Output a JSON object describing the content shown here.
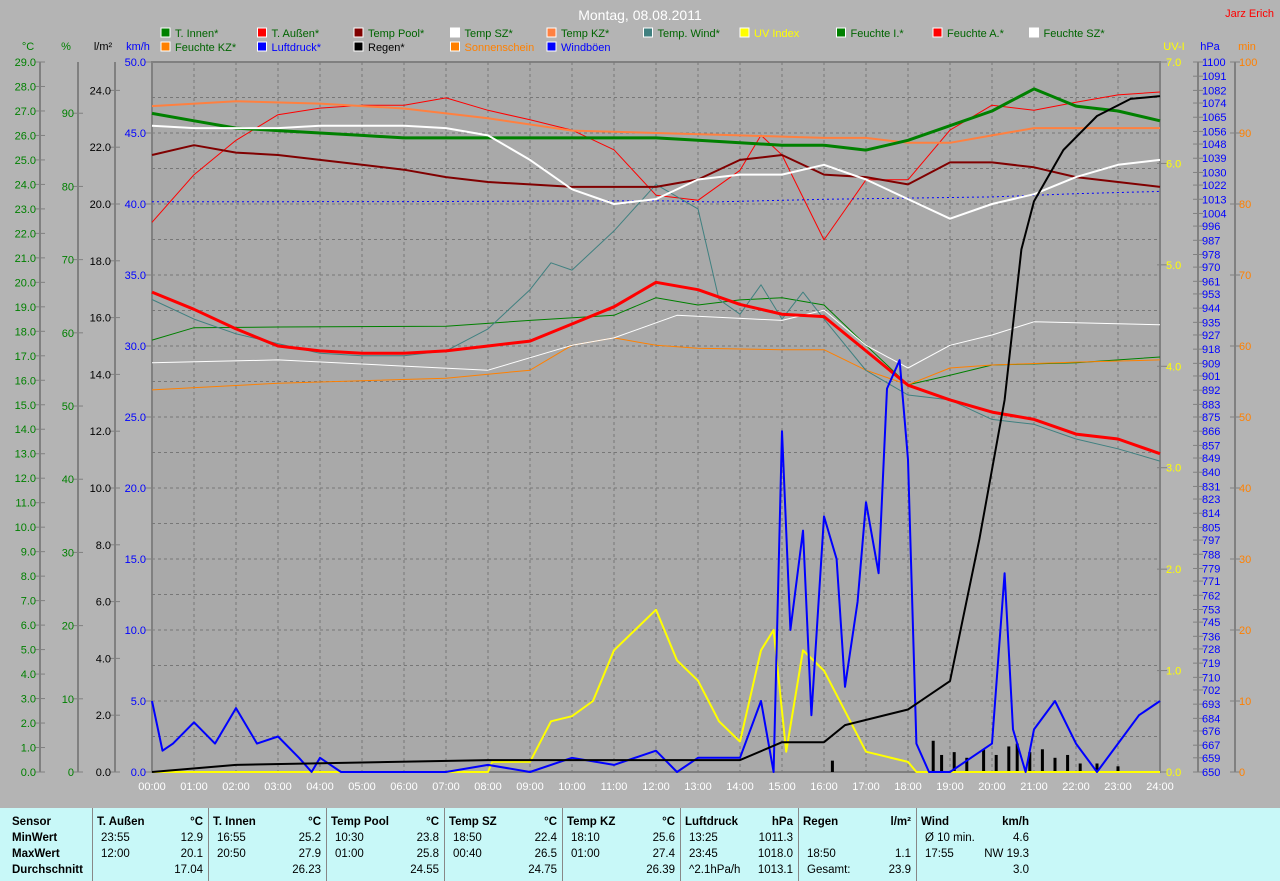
{
  "title": "Montag, 08.08.2011",
  "author": "Jarz Erich",
  "legend": [
    {
      "label": "T. Innen*",
      "color": "#008000",
      "text": "#006400"
    },
    {
      "label": "T. Außen*",
      "color": "#ff0000",
      "text": "#006400"
    },
    {
      "label": "Temp Pool*",
      "color": "#800000",
      "text": "#006400"
    },
    {
      "label": "Temp SZ*",
      "color": "#ffffff",
      "text": "#006400"
    },
    {
      "label": "Temp KZ*",
      "color": "#ff8040",
      "text": "#006400"
    },
    {
      "label": "Temp. Wind*",
      "color": "#408080",
      "text": "#006400"
    },
    {
      "label": "UV Index",
      "color": "#ffff00",
      "text": "#ffff00"
    },
    {
      "label": "Feuchte I.*",
      "color": "#008000",
      "text": "#006400"
    },
    {
      "label": "Feuchte A.*",
      "color": "#ff0000",
      "text": "#006400"
    },
    {
      "label": "Feuchte SZ*",
      "color": "#ffffff",
      "text": "#006400"
    },
    {
      "label": "Feuchte KZ*",
      "color": "#ff8000",
      "text": "#006400"
    },
    {
      "label": "Luftdruck*",
      "color": "#0000ff",
      "text": "#0000ff"
    },
    {
      "label": "Regen*",
      "color": "#000000",
      "text": "#000000"
    },
    {
      "label": "Sonnenschein",
      "color": "#ff8000",
      "text": "#ff8000"
    },
    {
      "label": "Windböen",
      "color": "#0000ff",
      "text": "#0000ff"
    }
  ],
  "chart_data": {
    "type": "line",
    "title": "Montag, 08.08.2011",
    "xlabel": "",
    "xlim": [
      0,
      24
    ],
    "x_ticks": [
      "00:00",
      "01:00",
      "02:00",
      "03:00",
      "04:00",
      "05:00",
      "06:00",
      "07:00",
      "08:00",
      "09:00",
      "10:00",
      "11:00",
      "12:00",
      "13:00",
      "14:00",
      "15:00",
      "16:00",
      "17:00",
      "18:00",
      "19:00",
      "20:00",
      "21:00",
      "22:00",
      "23:00",
      "24:00"
    ],
    "axes": {
      "C": {
        "unit": "°C",
        "range": [
          0,
          29
        ],
        "color": "#008000",
        "ticks": [
          "0.0",
          "1.0",
          "2.0",
          "3.0",
          "4.0",
          "5.0",
          "6.0",
          "7.0",
          "8.0",
          "9.0",
          "10.0",
          "11.0",
          "12.0",
          "13.0",
          "14.0",
          "15.0",
          "16.0",
          "17.0",
          "18.0",
          "19.0",
          "20.0",
          "21.0",
          "22.0",
          "23.0",
          "24.0",
          "25.0",
          "26.0",
          "27.0",
          "28.0",
          "29.0"
        ]
      },
      "pct": {
        "unit": "%",
        "range": [
          0,
          97
        ],
        "color": "#008000",
        "ticks": [
          "0",
          "10",
          "20",
          "30",
          "40",
          "50",
          "60",
          "70",
          "80",
          "90"
        ]
      },
      "lm2": {
        "unit": "l/m²",
        "range": [
          0,
          25
        ],
        "color": "#000000",
        "ticks": [
          "0.0",
          "2.0",
          "4.0",
          "6.0",
          "8.0",
          "10.0",
          "12.0",
          "14.0",
          "16.0",
          "18.0",
          "20.0",
          "22.0",
          "24.0"
        ]
      },
      "kmh": {
        "unit": "km/h",
        "range": [
          0,
          50
        ],
        "color": "#0000ff",
        "ticks": [
          "0.0",
          "5.0",
          "10.0",
          "15.0",
          "20.0",
          "25.0",
          "30.0",
          "35.0",
          "40.0",
          "45.0",
          "50.0"
        ]
      },
      "uv": {
        "unit": "UV-I",
        "range": [
          0,
          7
        ],
        "color": "#ffff00",
        "ticks": [
          "0.0",
          "1.0",
          "2.0",
          "3.0",
          "4.0",
          "5.0",
          "6.0",
          "7.0"
        ]
      },
      "hpa": {
        "unit": "hPa",
        "range": [
          650,
          1100
        ],
        "color": "#0000ff",
        "ticks": [
          "650",
          "659",
          "667",
          "676",
          "684",
          "693",
          "702",
          "710",
          "719",
          "728",
          "736",
          "745",
          "753",
          "762",
          "771",
          "779",
          "788",
          "797",
          "805",
          "814",
          "823",
          "831",
          "840",
          "849",
          "857",
          "866",
          "875",
          "883",
          "892",
          "901",
          "909",
          "918",
          "927",
          "935",
          "944",
          "953",
          "961",
          "970",
          "978",
          "987",
          "996",
          "1004",
          "1013",
          "1022",
          "1030",
          "1039",
          "1048",
          "1056",
          "1065",
          "1074",
          "1082",
          "1091",
          "1100"
        ]
      },
      "min": {
        "unit": "min",
        "range": [
          0,
          100
        ],
        "color": "#ff8000",
        "ticks": [
          "0",
          "10",
          "20",
          "30",
          "40",
          "50",
          "60",
          "70",
          "80",
          "90",
          "100"
        ]
      }
    },
    "series": [
      {
        "name": "Feuchte A.",
        "axis": "pct",
        "color": "#ff0000",
        "width": 1,
        "x": [
          0,
          1,
          2,
          3,
          4,
          5,
          6,
          7,
          8,
          9,
          10,
          11,
          12,
          13,
          14,
          14.5,
          15,
          16,
          16.5,
          17,
          18,
          19,
          20,
          21,
          22,
          23,
          24
        ],
        "y": [
          75.1,
          81.6,
          86.3,
          89.8,
          90.7,
          91.1,
          91.1,
          92.1,
          90.4,
          89.1,
          87.7,
          85,
          78.8,
          78.1,
          82.2,
          87,
          84.3,
          72.7,
          76.8,
          80.9,
          80.9,
          87.7,
          91.1,
          90.4,
          91.5,
          92.5,
          92.9
        ]
      },
      {
        "name": "Feuchte I.",
        "axis": "pct",
        "color": "#008000",
        "width": 1,
        "x": [
          0,
          1,
          3,
          7,
          9,
          11,
          12,
          13,
          14,
          15,
          16,
          17,
          18,
          19,
          20,
          22,
          24
        ],
        "y": [
          59,
          60.7,
          60.8,
          60.9,
          61.7,
          62.4,
          64.8,
          63.8,
          64.5,
          64.8,
          63.8,
          58.3,
          52.9,
          54.2,
          55.6,
          55.9,
          56.7
        ]
      },
      {
        "name": "Feuchte KZ",
        "axis": "pct",
        "color": "#ff8000",
        "width": 1,
        "x": [
          0,
          3,
          7,
          9,
          10,
          11,
          12,
          13,
          15,
          16,
          17,
          18,
          19,
          20,
          22,
          24
        ],
        "y": [
          52.2,
          53.1,
          53.8,
          54.9,
          58.3,
          59.3,
          58.3,
          57.9,
          57.7,
          57.7,
          54.9,
          52.9,
          55.2,
          55.6,
          56,
          56.3
        ]
      },
      {
        "name": "Feuchte SZ",
        "axis": "pct",
        "color": "#ffffff",
        "width": 1,
        "x": [
          0,
          3,
          8,
          10,
          11,
          12.5,
          15,
          16,
          17,
          18,
          19,
          20,
          21,
          24
        ],
        "y": [
          55.9,
          56.3,
          54.9,
          58.3,
          59.3,
          62.4,
          61.7,
          63.1,
          58.3,
          55.2,
          58.3,
          59.7,
          61.5,
          61.1
        ]
      },
      {
        "name": "Temp. Wind",
        "axis": "C",
        "color": "#408080",
        "width": 1,
        "x": [
          0,
          1,
          2,
          3,
          4,
          5,
          6,
          7,
          8,
          9,
          9.5,
          10,
          11,
          12,
          13,
          13.5,
          14,
          14.5,
          15,
          15.5,
          16,
          17,
          18,
          19,
          20,
          21,
          22,
          23,
          24
        ],
        "y": [
          19.3,
          18.5,
          17.9,
          17.5,
          17.1,
          17,
          17,
          17.2,
          18.1,
          19.7,
          20.8,
          20.5,
          22.1,
          24,
          23,
          19.3,
          18.7,
          19.9,
          18.5,
          19.6,
          18.5,
          16.4,
          15.4,
          15.2,
          14.4,
          14.2,
          13.6,
          13.2,
          12.7
        ]
      },
      {
        "name": "Luftdruck",
        "axis": "hpa",
        "color": "#0000ff",
        "width": 1,
        "dash": true,
        "x": [
          0,
          6,
          12,
          13.4,
          16,
          20,
          22,
          24
        ],
        "y": [
          1011.4,
          1011.5,
          1012,
          1011.3,
          1013,
          1014.5,
          1016.5,
          1018
        ]
      },
      {
        "name": "T. Außen",
        "axis": "C",
        "color": "#ff0000",
        "width": 3,
        "x": [
          0,
          1,
          2,
          3,
          4,
          5,
          6,
          7,
          8,
          9,
          10,
          11,
          12,
          13,
          14,
          15,
          16,
          17,
          18,
          19,
          20,
          21,
          22,
          23,
          24
        ],
        "y": [
          19.6,
          18.9,
          18.1,
          17.4,
          17.2,
          17.1,
          17.1,
          17.2,
          17.4,
          17.6,
          18.3,
          19,
          20,
          19.7,
          19.1,
          18.7,
          18.6,
          17.2,
          15.8,
          15.2,
          14.7,
          14.4,
          13.8,
          13.6,
          13
        ]
      },
      {
        "name": "Temp KZ",
        "axis": "C",
        "color": "#ff8040",
        "width": 2,
        "x": [
          0,
          2,
          4,
          6,
          8,
          10,
          12,
          14,
          16,
          17,
          18,
          19,
          20,
          21,
          22,
          24
        ],
        "y": [
          27.2,
          27.4,
          27.3,
          27.1,
          26.7,
          26.2,
          26.1,
          26,
          25.9,
          25.9,
          25.7,
          25.7,
          26,
          26.3,
          26.3,
          26.3
        ]
      },
      {
        "name": "T. Innen",
        "axis": "C",
        "color": "#008000",
        "width": 3,
        "x": [
          0,
          1,
          2,
          3,
          4,
          5,
          6,
          7,
          8,
          9,
          10,
          11,
          12,
          13,
          14,
          15,
          16,
          17,
          18,
          19,
          20,
          21,
          22,
          23,
          24
        ],
        "y": [
          26.9,
          26.6,
          26.3,
          26.2,
          26.1,
          26,
          25.9,
          25.9,
          25.9,
          25.9,
          25.9,
          25.9,
          25.9,
          25.8,
          25.7,
          25.6,
          25.6,
          25.4,
          25.8,
          26.4,
          27,
          27.9,
          27.2,
          27,
          26.6
        ]
      },
      {
        "name": "Temp Pool",
        "axis": "C",
        "color": "#800000",
        "width": 2,
        "x": [
          0,
          1,
          2,
          3,
          4,
          5,
          6,
          7,
          8,
          9,
          10,
          11,
          12,
          13,
          14,
          15,
          16,
          17,
          18,
          19,
          20,
          21,
          22,
          23,
          24
        ],
        "y": [
          25.2,
          25.6,
          25.3,
          25.2,
          25,
          24.8,
          24.6,
          24.3,
          24.1,
          24,
          23.9,
          23.9,
          23.9,
          24.2,
          25,
          25.2,
          24.4,
          24.3,
          24,
          24.9,
          24.9,
          24.7,
          24.3,
          24.1,
          23.9
        ]
      },
      {
        "name": "Temp SZ",
        "axis": "C",
        "color": "#ffffff",
        "width": 2,
        "x": [
          0,
          1,
          2,
          3,
          4,
          5,
          6,
          7,
          8,
          9,
          10,
          11,
          12,
          13,
          14,
          15,
          16,
          17,
          18,
          19,
          20,
          21,
          22,
          23,
          24
        ],
        "y": [
          26.4,
          26.3,
          26.3,
          26.3,
          26.4,
          26.4,
          26.4,
          26.3,
          26,
          25,
          23.8,
          23.2,
          23.4,
          24.2,
          24.4,
          24.4,
          24.8,
          24.2,
          23.4,
          22.6,
          23.2,
          23.6,
          24.3,
          24.8,
          25
        ]
      },
      {
        "name": "UV Index",
        "axis": "uv",
        "color": "#ffff00",
        "width": 2,
        "x": [
          0,
          8,
          8.1,
          9,
          9.5,
          10,
          10.5,
          11,
          11.5,
          12,
          12.5,
          13,
          13.5,
          14,
          14.5,
          14.8,
          15.1,
          15.5,
          16,
          16.5,
          17,
          18,
          18.2,
          24
        ],
        "y": [
          0,
          0,
          0.1,
          0.1,
          0.5,
          0.55,
          0.7,
          1.2,
          1.4,
          1.6,
          1.1,
          0.9,
          0.5,
          0.3,
          1.2,
          1.4,
          0.2,
          1.2,
          1,
          0.6,
          0.2,
          0.1,
          0,
          0
        ]
      },
      {
        "name": "Windböen",
        "axis": "kmh",
        "color": "#0000ff",
        "width": 2,
        "x": [
          0,
          0.25,
          0.5,
          1,
          1.5,
          2,
          2.5,
          3,
          3.5,
          3.8,
          4,
          4.5,
          5,
          7,
          8,
          9,
          10,
          11,
          12,
          12.5,
          13,
          14,
          14.5,
          14.8,
          15,
          15.2,
          15.5,
          15.7,
          16,
          16.3,
          16.5,
          16.8,
          17,
          17.3,
          17.5,
          17.8,
          18,
          18.2,
          18.5,
          19,
          20,
          20.3,
          20.5,
          20.8,
          21,
          21.5,
          22,
          22.5,
          23,
          23.5,
          24
        ],
        "y": [
          5,
          1.5,
          2,
          3.5,
          2,
          4.5,
          2,
          2.5,
          1,
          0,
          1,
          0,
          0,
          0,
          0.5,
          0,
          1,
          0.5,
          1.5,
          0,
          1,
          1,
          5,
          0,
          24,
          10,
          17,
          4,
          18,
          15,
          6,
          12,
          19,
          14,
          27,
          29,
          22,
          2,
          0,
          0,
          2,
          14,
          3,
          0,
          3,
          5,
          2,
          0,
          2,
          4,
          5
        ]
      },
      {
        "name": "Regen",
        "axis": "lm2",
        "color": "#000000",
        "width": 2,
        "x": [
          0,
          2,
          8,
          14,
          15,
          16,
          16.5,
          18,
          18.2,
          19,
          19.7,
          20.3,
          20.7,
          21,
          21.7,
          22.5,
          23.3,
          24
        ],
        "y": [
          0,
          0.25,
          0.42,
          0.42,
          1.05,
          1.05,
          1.65,
          2.2,
          2.4,
          3.2,
          8.2,
          13.1,
          18.4,
          20.1,
          21.9,
          23.1,
          23.7,
          23.8
        ]
      }
    ],
    "rain_bars": {
      "axis": "lm2",
      "color": "#000000",
      "x": [
        16.2,
        18.6,
        18.8,
        19.1,
        19.4,
        19.8,
        20.1,
        20.4,
        20.6,
        20.9,
        21.2,
        21.5,
        21.8,
        22.1,
        22.5,
        23
      ],
      "y": [
        0.4,
        1.1,
        0.6,
        0.7,
        0.5,
        0.8,
        0.6,
        0.9,
        1,
        0.7,
        0.8,
        0.5,
        0.6,
        0.3,
        0.3,
        0.2
      ]
    }
  },
  "table": {
    "columns": [
      {
        "h": "Sensor",
        "rows": [
          "MinWert",
          "MaxWert",
          "Durchschnitt"
        ],
        "bold": true
      },
      {
        "h": "T. Außen",
        "u": "°C",
        "t": [
          "23:55",
          "12:00",
          ""
        ],
        "v": [
          "12.9",
          "20.1",
          "17.04"
        ]
      },
      {
        "h": "T. Innen",
        "u": "°C",
        "t": [
          "16:55",
          "20:50",
          ""
        ],
        "v": [
          "25.2",
          "27.9",
          "26.23"
        ]
      },
      {
        "h": "Temp Pool",
        "u": "°C",
        "t": [
          "10:30",
          "01:00",
          ""
        ],
        "v": [
          "23.8",
          "25.8",
          "24.55"
        ]
      },
      {
        "h": "Temp SZ",
        "u": "°C",
        "t": [
          "18:50",
          "00:40",
          ""
        ],
        "v": [
          "22.4",
          "26.5",
          "24.75"
        ]
      },
      {
        "h": "Temp KZ",
        "u": "°C",
        "t": [
          "18:10",
          "01:00",
          ""
        ],
        "v": [
          "25.6",
          "27.4",
          "26.39"
        ]
      },
      {
        "h": "Luftdruck",
        "u": "hPa",
        "t": [
          "13:25",
          "23:45",
          "^2.1hPa/h"
        ],
        "v": [
          "1011.3",
          "1018.0",
          "1013.1"
        ]
      },
      {
        "h": "Regen",
        "u": "l/m²",
        "t": [
          "",
          "18:50",
          "Gesamt:"
        ],
        "v": [
          "",
          "1.1",
          "23.9"
        ]
      },
      {
        "h": "Wind",
        "u": "km/h",
        "t": [
          "Ø 10 min.",
          "17:55",
          ""
        ],
        "v": [
          "4.6",
          "NW 19.3",
          "3.0"
        ]
      }
    ]
  }
}
